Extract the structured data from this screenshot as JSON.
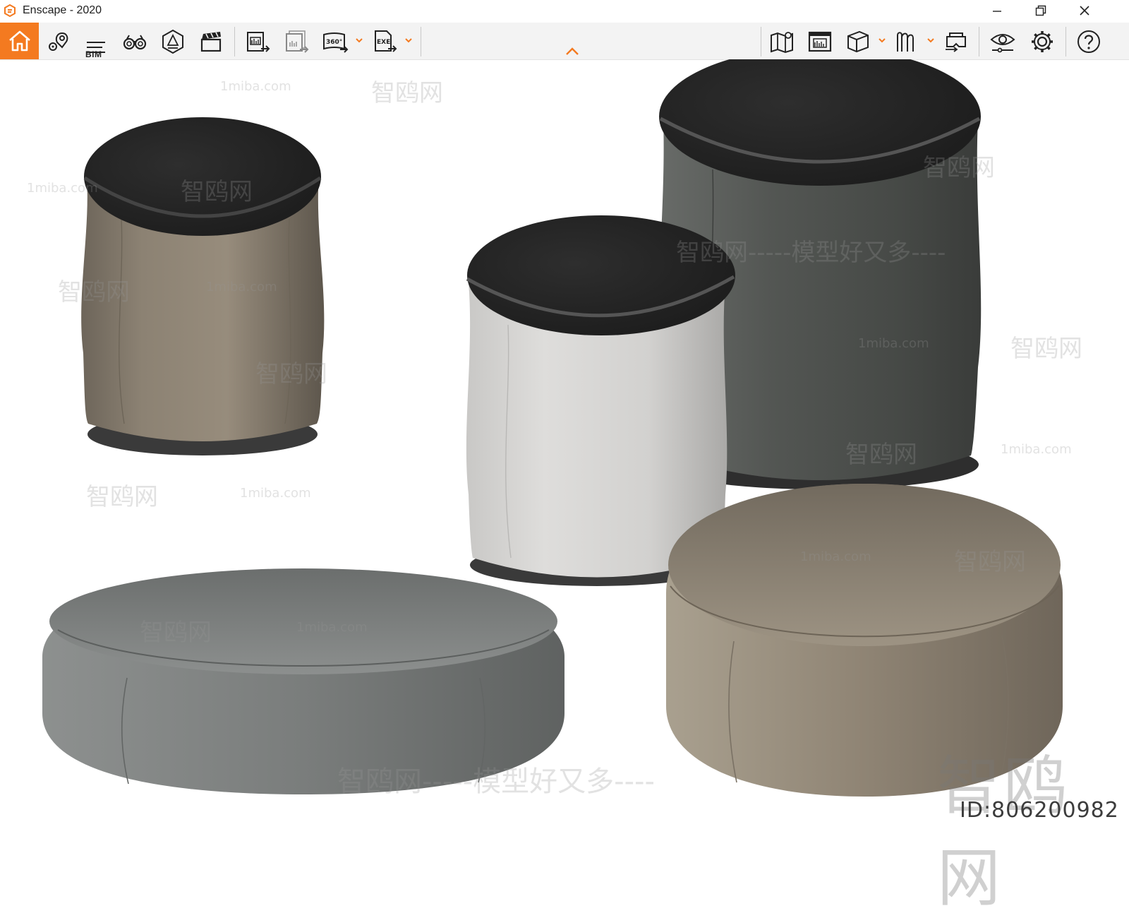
{
  "window": {
    "title": "Enscape - 2020",
    "accent_color": "#f47a20",
    "controls": [
      "minimize-icon",
      "restore-icon",
      "close-icon"
    ]
  },
  "toolbar": {
    "left_buttons": [
      "home-icon",
      "map-pin-icon",
      "bim-icon",
      "binoculars-icon",
      "hexagon-light-icon",
      "clapperboard-icon"
    ],
    "bim_label": "BIM",
    "export_buttons": [
      "export-image-icon",
      "batch-render-icon",
      "export-360-icon",
      "export-exe-icon"
    ],
    "export_360_label": "360°",
    "export_exe_label": "EXE",
    "right_buttons": [
      "map-icon",
      "screenshots-icon",
      "cube-view-icon",
      "asset-library-icon",
      "vr-headset-icon",
      "visual-settings-icon",
      "settings-gear-icon",
      "help-icon"
    ],
    "collapse_icon": "chevron-up-icon"
  },
  "viewport": {
    "background": "#ffffff",
    "objects": [
      {
        "name": "tan-leather-stool",
        "body_color": "#8c8273",
        "top_color": "#262626"
      },
      {
        "name": "white-boucle-stool",
        "body_color": "#d6d5d3",
        "top_color": "#2a2a2a"
      },
      {
        "name": "dark-gray-stool",
        "body_color": "#4f524f",
        "top_color": "#232323"
      },
      {
        "name": "gray-round-pouf",
        "body_color": "#7a7d7c"
      },
      {
        "name": "taupe-round-pouf",
        "body_color": "#8f8474"
      }
    ],
    "watermarks": {
      "small_site": "1miba.com",
      "brand": "智鸥网",
      "slogan": "智鸥网-----模型好又多----",
      "big_brand": "智鸥网",
      "id_label": "ID:806200982"
    }
  }
}
